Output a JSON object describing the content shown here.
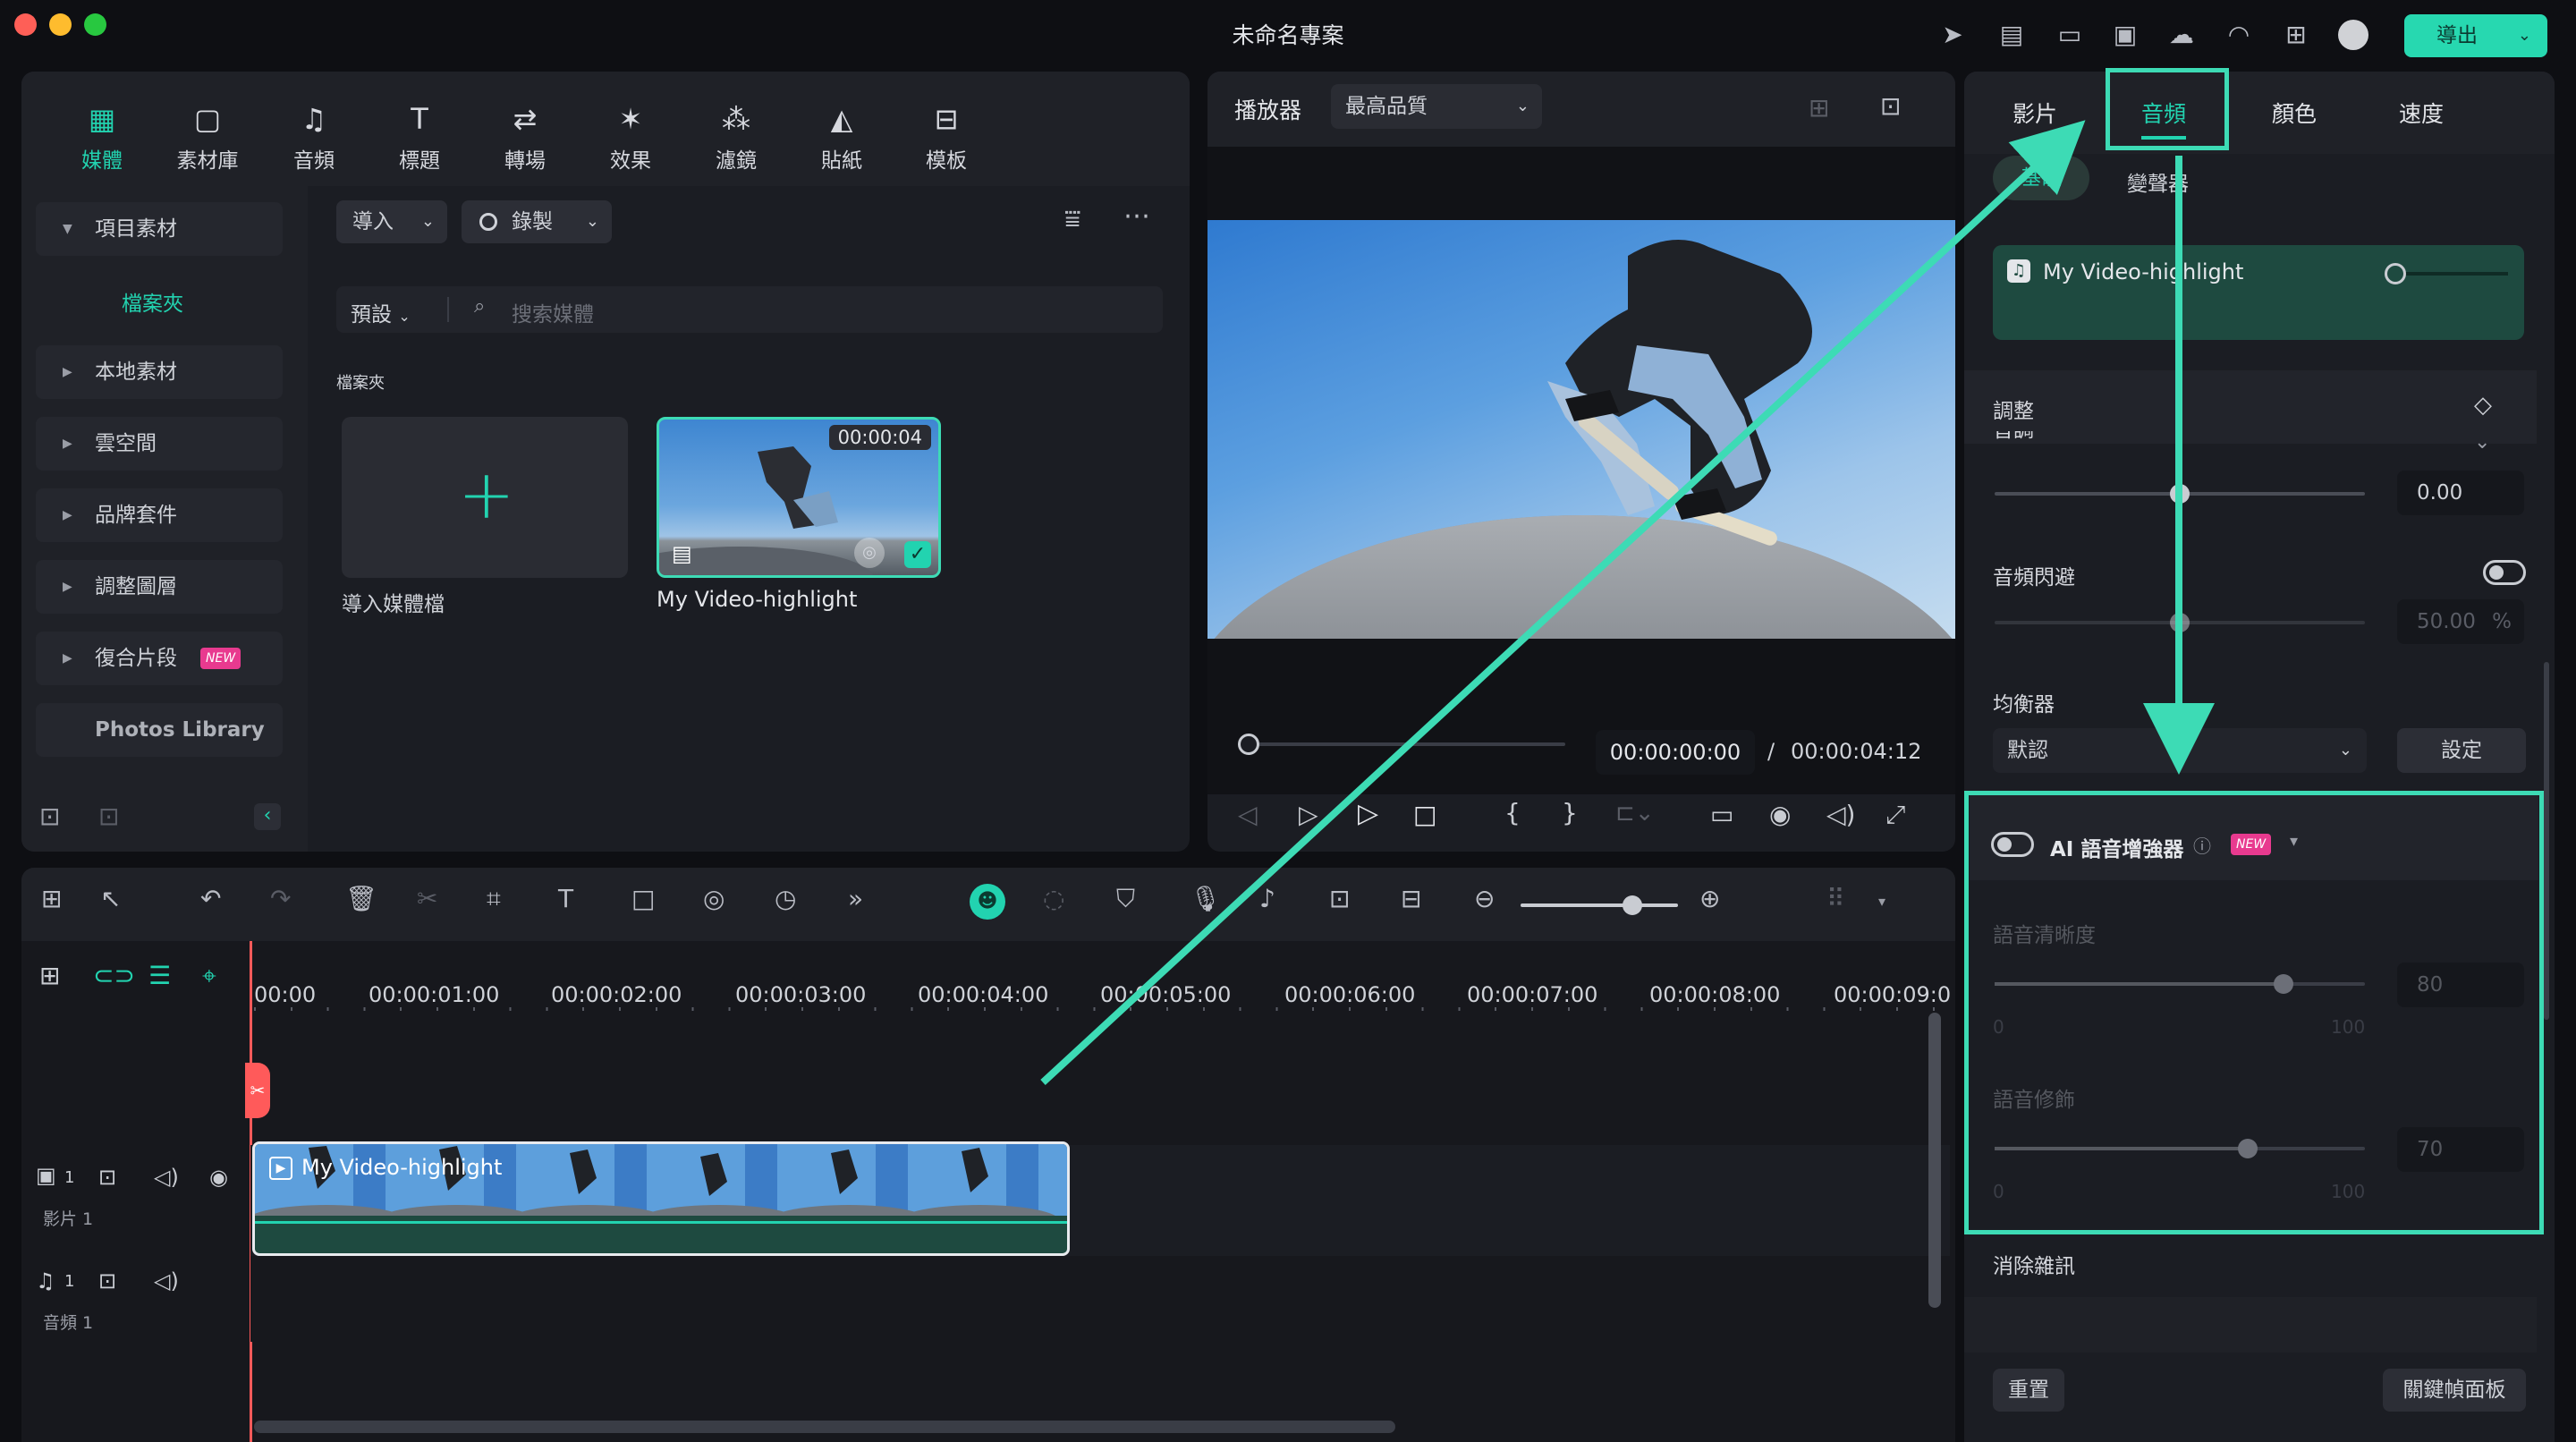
{
  "window": {
    "title": "未命名專案",
    "export_label": "導出"
  },
  "toolbar": {
    "tabs": [
      {
        "label": "媒體",
        "icon": "media-icon",
        "active": true
      },
      {
        "label": "素材庫",
        "icon": "stock-icon"
      },
      {
        "label": "音頻",
        "icon": "music-note-icon"
      },
      {
        "label": "標題",
        "icon": "text-icon"
      },
      {
        "label": "轉場",
        "icon": "transition-icon"
      },
      {
        "label": "效果",
        "icon": "effects-icon"
      },
      {
        "label": "濾鏡",
        "icon": "filters-icon"
      },
      {
        "label": "貼紙",
        "icon": "sticker-icon"
      },
      {
        "label": "模板",
        "icon": "template-icon"
      }
    ]
  },
  "sidebar": {
    "items": [
      {
        "label": "項目素材",
        "expanded": true
      },
      {
        "label": "檔案夾"
      },
      {
        "label": "本地素材"
      },
      {
        "label": "雲空間"
      },
      {
        "label": "品牌套件"
      },
      {
        "label": "調整圖層"
      },
      {
        "label": "復合片段",
        "badge": "NEW"
      },
      {
        "label": "Photos Library"
      }
    ]
  },
  "media": {
    "import_label": "導入",
    "record_label": "錄製",
    "preset_label": "預設",
    "search_placeholder": "搜索媒體",
    "folder_label": "檔案夾",
    "import_card_label": "導入媒體檔",
    "clip": {
      "name": "My Video-highlight",
      "duration": "00:00:04"
    }
  },
  "player": {
    "label": "播放器",
    "quality": "最高品質",
    "current_time": "00:00:00:00",
    "separator": "/",
    "total_time": "00:00:04:12"
  },
  "inspector": {
    "tabs": [
      "影片",
      "音頻",
      "顏色",
      "速度"
    ],
    "active_tab": "音頻",
    "subtabs": [
      "基礎",
      "變聲器"
    ],
    "clip_name": "My Video-highlight",
    "adjust_label": "調整",
    "pitch_label": "音調",
    "pitch_value": "0.00",
    "ducking_label": "音頻閃避",
    "ducking_value": "50.00",
    "ducking_unit": "%",
    "eq_label": "均衡器",
    "eq_value": "默認",
    "eq_button": "設定",
    "ai_enhancer": {
      "label": "AI 語音增強器",
      "badge": "NEW",
      "clarity_label": "語音清晰度",
      "clarity_value": "80",
      "clarity_min": "0",
      "clarity_max": "100",
      "polish_label": "語音修飾",
      "polish_value": "70",
      "polish_min": "0",
      "polish_max": "100"
    },
    "denoise_label": "消除雜訊",
    "reset_label": "重置",
    "keyframe_label": "關鍵幀面板"
  },
  "timeline": {
    "ticks": [
      "00:00",
      "00:00:01:00",
      "00:00:02:00",
      "00:00:03:00",
      "00:00:04:00",
      "00:00:05:00",
      "00:00:06:00",
      "00:00:07:00",
      "00:00:08:00",
      "00:00:09:0"
    ],
    "video_track": {
      "number": "1",
      "name": "影片 1"
    },
    "audio_track": {
      "number": "1",
      "name": "音頻 1"
    },
    "clip_label": "My Video-highlight"
  },
  "colors": {
    "accent": "#22d3b0",
    "highlight": "#3ddbb5",
    "background": "#0e0f13",
    "panel": "#1b1d23"
  }
}
